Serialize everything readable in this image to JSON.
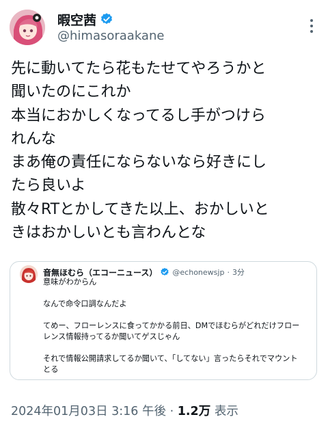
{
  "author": {
    "display_name": "暇空茜",
    "handle": "@himasoraakane"
  },
  "tweet": {
    "lines": [
      "先に動いてたら花もたせてやろうかと",
      "聞いたのにこれか",
      "本当におかしくなってるし手がつけら",
      "れんな",
      "まあ俺の責任にならないなら好きにし",
      "たら良いよ",
      "散々RTとかしてきた以上、おかしいと",
      "きはおかしいとも言わんとな"
    ]
  },
  "quoted": {
    "display_name": "音無ほむら（エコーニュース）",
    "handle": "@echonewsjp",
    "separator": "·",
    "time": "3分",
    "lines": [
      "意味がわからん",
      "",
      "なんで命令口調なんだよ",
      "",
      "てめー、フローレンスに食ってかかる前日、DMでほむらがどれだけフロー",
      "レンス情報持ってるか聞いてゲスじゃん",
      "",
      "それで情報公開請求してるか聞いて、「してない」言ったらそれでマウント",
      "とる",
      "..."
    ]
  },
  "footer": {
    "datetime": "2024年01月03日 3:16 午後",
    "separator": "·",
    "views": "1.2万",
    "views_label": "表示"
  },
  "colors": {
    "verified": "#1d9bf0",
    "secondary_text": "#536471",
    "border": "#cfd9de"
  },
  "icons": {
    "verified": "verified-badge-icon",
    "more": "more-options-icon"
  }
}
